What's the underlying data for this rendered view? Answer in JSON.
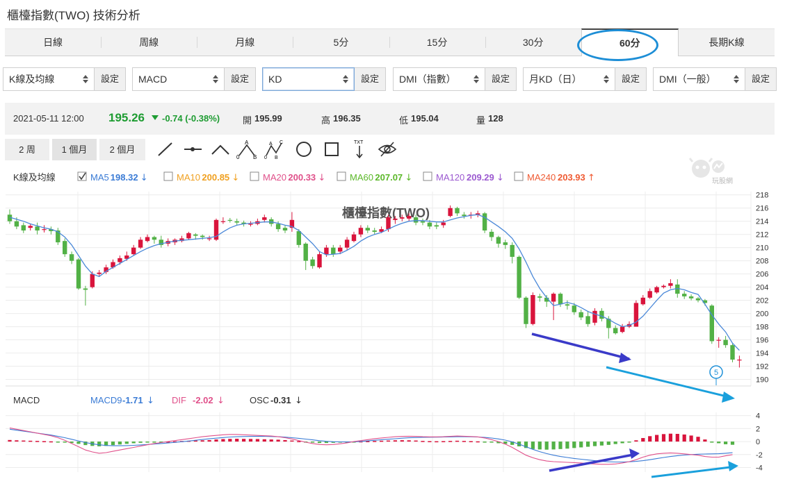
{
  "title": "櫃檯指數(TWO) 技術分析",
  "tabs": [
    {
      "label": "日線"
    },
    {
      "label": "周線"
    },
    {
      "label": "月線"
    },
    {
      "label": "5分"
    },
    {
      "label": "15分"
    },
    {
      "label": "30分"
    },
    {
      "label": "60分",
      "active": true
    },
    {
      "label": "長期K線"
    }
  ],
  "selectors": [
    {
      "value": "K線及均線",
      "button": "設定"
    },
    {
      "value": "MACD",
      "button": "設定"
    },
    {
      "value": "KD",
      "button": "設定"
    },
    {
      "value": "DMI（指數）",
      "button": "設定"
    },
    {
      "value": "月KD（日）",
      "button": "設定"
    },
    {
      "value": "DMI（一般）",
      "button": "設定"
    }
  ],
  "quote": {
    "time": "2021-05-11 12:00",
    "price": "195.26",
    "change": "-0.74 (-0.38%)",
    "open_label": "開",
    "open": "195.99",
    "high_label": "高",
    "high": "196.35",
    "low_label": "低",
    "low": "195.04",
    "vol_label": "量",
    "vol": "128"
  },
  "ranges": [
    {
      "label": "2 周"
    },
    {
      "label": "1 個月",
      "active": true
    },
    {
      "label": "2 個月"
    }
  ],
  "tools": [
    "line-tool-icon",
    "horizontal-line-icon",
    "angle-tool-icon",
    "abc-pattern-icon",
    "abcd-pattern-icon",
    "circle-tool-icon",
    "rectangle-tool-icon",
    "text-tool-icon",
    "hide-drawings-icon"
  ],
  "tool_text": {
    "a": "A",
    "b": "B",
    "c": "C",
    "zero": "0",
    "txt": "TXT"
  },
  "watermark": "櫃檯指數(TWO)",
  "logo": "玩股網",
  "colors": {
    "up": "#d9143c",
    "down": "#52b146",
    "ma5": "#4a88d8",
    "arrow_dark": "#3a3ac8",
    "arrow_light": "#1aa0dc"
  },
  "ma_legend": {
    "title": "K線及均線",
    "items": [
      {
        "name": "MA5",
        "value": "198.32",
        "arrow": "↓",
        "color": "#3a7bd5",
        "checked": true
      },
      {
        "name": "MA10",
        "value": "200.85",
        "arrow": "↓",
        "color": "#f0a020",
        "checked": false
      },
      {
        "name": "MA20",
        "value": "200.33",
        "arrow": "↓",
        "color": "#e0508a",
        "checked": false
      },
      {
        "name": "MA60",
        "value": "207.07",
        "arrow": "↓",
        "color": "#5cb82a",
        "checked": false
      },
      {
        "name": "MA120",
        "value": "209.29",
        "arrow": "↓",
        "color": "#9b59d0",
        "checked": false
      },
      {
        "name": "MA240",
        "value": "203.93",
        "arrow": "↑",
        "color": "#ef5a32",
        "checked": false
      }
    ]
  },
  "macd_legend": {
    "title": "MACD",
    "items": [
      {
        "name": "MACD9",
        "value": "-1.71",
        "arrow": "↓",
        "color": "#3a7bd5"
      },
      {
        "name": "DIF",
        "value": "-2.02",
        "arrow": "↓",
        "color": "#e0508a"
      },
      {
        "name": "OSC",
        "value": "-0.31",
        "arrow": "↓",
        "color": "#333333"
      }
    ]
  },
  "badge": "5",
  "chart_data": [
    {
      "type": "candlestick",
      "yticks": [
        "218",
        "216",
        "214",
        "212",
        "210",
        "208",
        "206",
        "204",
        "202",
        "200",
        "198",
        "196",
        "194",
        "192",
        "190"
      ],
      "ylim": [
        189,
        218.5
      ],
      "candles": [
        [
          215,
          214,
          215.8,
          213.6
        ],
        [
          214,
          213.2,
          214.6,
          212.8
        ],
        [
          213.4,
          212.6,
          213.8,
          212.2
        ],
        [
          213,
          213.3,
          213.6,
          212.6
        ],
        [
          213.2,
          212.6,
          213.8,
          212
        ],
        [
          212.8,
          212.8,
          213.4,
          212.3
        ],
        [
          212.8,
          212.5,
          213.2,
          212
        ],
        [
          212.6,
          210.8,
          213,
          210.4
        ],
        [
          211,
          209,
          211.4,
          208.6
        ],
        [
          209,
          208,
          209.4,
          207.5
        ],
        [
          208.2,
          203.8,
          208.4,
          203.6
        ],
        [
          203.8,
          203.6,
          204.2,
          201.2
        ],
        [
          204,
          206,
          206.4,
          203.8
        ],
        [
          206,
          206.2,
          206.6,
          205.6
        ],
        [
          206.3,
          207,
          207.4,
          206
        ],
        [
          207,
          207.8,
          208.2,
          206.8
        ],
        [
          207.8,
          208.4,
          208.8,
          207.4
        ],
        [
          208.3,
          208.8,
          209.4,
          208
        ],
        [
          209,
          210,
          210.4,
          208.8
        ],
        [
          210,
          211.2,
          211.6,
          209.8
        ],
        [
          211,
          211.6,
          212,
          210.8
        ],
        [
          211.6,
          211.2,
          211.8,
          210.6
        ],
        [
          211.2,
          210.4,
          211.8,
          210
        ],
        [
          210.6,
          211,
          211.4,
          210.2
        ],
        [
          210.8,
          211.2,
          211.4,
          210.4
        ],
        [
          211,
          211.4,
          211.8,
          210.8
        ],
        [
          211.4,
          212.2,
          212.4,
          211.2
        ],
        [
          212,
          211.8,
          212.2,
          211.2
        ],
        [
          211.8,
          211.6,
          212,
          211.2
        ],
        [
          211.4,
          211.4,
          211.8,
          211
        ],
        [
          211.2,
          214.2,
          214.4,
          211
        ],
        [
          214,
          214,
          214.6,
          213.6
        ],
        [
          214.2,
          214.1,
          214.5,
          213.8
        ],
        [
          214,
          213.8,
          214.4,
          213.4
        ],
        [
          213.8,
          213.6,
          214.1,
          213.2
        ],
        [
          213.6,
          213.6,
          214,
          213.2
        ],
        [
          213.6,
          214,
          214.4,
          213.4
        ],
        [
          214.2,
          214.6,
          215,
          213.8
        ],
        [
          214.3,
          213.6,
          214.6,
          213.2
        ],
        [
          213.6,
          212.8,
          214,
          212.4
        ],
        [
          213,
          212.6,
          213.4,
          212.2
        ],
        [
          213,
          214.2,
          215.4,
          212.4
        ],
        [
          212.5,
          210.4,
          212.8,
          210
        ],
        [
          210.6,
          208,
          210.8,
          206.6
        ],
        [
          208.2,
          207.2,
          208.6,
          206.8
        ],
        [
          207,
          209,
          209.4,
          206.8
        ],
        [
          209,
          210,
          210.4,
          208.6
        ],
        [
          210,
          209,
          210.4,
          208.6
        ],
        [
          209.4,
          210,
          210.4,
          209
        ],
        [
          210,
          211.2,
          211.6,
          209.6
        ],
        [
          211,
          212,
          212.4,
          210.8
        ],
        [
          212,
          213,
          213.4,
          211.6
        ],
        [
          213,
          212.6,
          213.4,
          212.2
        ],
        [
          212.6,
          212.4,
          213,
          212
        ],
        [
          212.4,
          212.8,
          213.2,
          212.2
        ],
        [
          212.8,
          214.6,
          215,
          212.4
        ],
        [
          214.2,
          214.4,
          214.8,
          213.6
        ],
        [
          214.4,
          214.6,
          215,
          214
        ],
        [
          214.4,
          214.8,
          215.2,
          214
        ],
        [
          214.6,
          213.8,
          215,
          213.4
        ],
        [
          214,
          213.8,
          214.4,
          213.4
        ],
        [
          213.8,
          213.2,
          214.2,
          212.8
        ],
        [
          213.4,
          213.2,
          213.8,
          212.8
        ],
        [
          213.4,
          213.8,
          214.2,
          213
        ],
        [
          214.8,
          216,
          216.4,
          214.6
        ],
        [
          216,
          215.2,
          216.2,
          214.8
        ],
        [
          215,
          214.8,
          215.4,
          214.4
        ],
        [
          215,
          215,
          215.4,
          214.4
        ],
        [
          215,
          215.2,
          215.6,
          214.6
        ],
        [
          215.2,
          212.6,
          215.4,
          212.2
        ],
        [
          212.4,
          211.6,
          212.8,
          211
        ],
        [
          211.6,
          210.6,
          211.8,
          210
        ],
        [
          210.8,
          210.4,
          211.2,
          209.8
        ],
        [
          210.4,
          208.6,
          210.8,
          207.6
        ],
        [
          208.6,
          202.4,
          208.8,
          202.2
        ],
        [
          202.4,
          198.4,
          202.6,
          197.8
        ],
        [
          198.4,
          202.8,
          203.2,
          198.2
        ],
        [
          202.6,
          202.4,
          203,
          201.8
        ],
        [
          202.4,
          201.8,
          202.8,
          201
        ],
        [
          201.8,
          203,
          203.2,
          199
        ],
        [
          203,
          201.4,
          203.2,
          201
        ],
        [
          201.4,
          201.2,
          202,
          200.6
        ],
        [
          201.2,
          200.2,
          201.6,
          199.8
        ],
        [
          200.2,
          199.4,
          200.6,
          199
        ],
        [
          199.6,
          198.4,
          200.4,
          198
        ],
        [
          198.6,
          200.4,
          200.8,
          198.2
        ],
        [
          200.4,
          199.2,
          200.8,
          198.8
        ],
        [
          199.2,
          197.8,
          199.6,
          196.2
        ],
        [
          197.8,
          197,
          198.2,
          196.8
        ],
        [
          197.2,
          198,
          198.4,
          197
        ],
        [
          198,
          198.4,
          198.8,
          197.8
        ],
        [
          198,
          201.6,
          202,
          198
        ],
        [
          201.4,
          202.4,
          202.8,
          201.2
        ],
        [
          202.4,
          203.4,
          203.8,
          202.2
        ],
        [
          203.2,
          204,
          204.2,
          203
        ],
        [
          204,
          204.2,
          204.4,
          203.8
        ],
        [
          204.2,
          204.6,
          205.2,
          203.8
        ],
        [
          204.4,
          203,
          205.2,
          202.4
        ],
        [
          203,
          202.6,
          203.4,
          202.2
        ],
        [
          202.6,
          202.3,
          202.9,
          202
        ],
        [
          202.3,
          202,
          202.5,
          201.7
        ],
        [
          202,
          201.6,
          202.2,
          201.2
        ],
        [
          201.2,
          195.8,
          201.4,
          195.4
        ],
        [
          196,
          196,
          196.4,
          194.8
        ],
        [
          196,
          195.2,
          196.6,
          194.8
        ],
        [
          195.2,
          193,
          195.4,
          192.6
        ],
        [
          193,
          193,
          193.6,
          191.8
        ]
      ],
      "ma5": [
        214.6,
        214.3,
        214,
        213.6,
        213.3,
        213,
        212.8,
        212.4,
        211.6,
        210.4,
        208.8,
        207.2,
        206,
        205.6,
        206.4,
        207,
        207.6,
        208.2,
        208.8,
        209.4,
        209.9,
        210.3,
        210.6,
        210.8,
        211,
        211.1,
        211.2,
        211.3,
        211.4,
        211.5,
        211.7,
        212.4,
        213,
        213.4,
        213.6,
        213.7,
        213.8,
        213.9,
        213.9,
        213.7,
        213.4,
        213.2,
        212.6,
        211.6,
        210.6,
        209.4,
        208.9,
        209,
        209.1,
        209.6,
        210.2,
        211,
        211.6,
        212,
        212.3,
        212.8,
        213.3,
        213.7,
        214,
        214.1,
        214.1,
        214,
        213.9,
        213.9,
        214.2,
        214.5,
        214.7,
        214.9,
        215,
        214.6,
        213.9,
        213.2,
        212.4,
        211.4,
        209.8,
        207.8,
        205.6,
        203.8,
        202.4,
        201.2,
        201.4,
        201.7,
        201.4,
        200.9,
        200.3,
        199.9,
        199.6,
        199.1,
        198.5,
        198,
        198.2,
        198.7,
        199.6,
        200.8,
        202,
        203.1,
        203.6,
        203.8,
        203.6,
        203.2,
        202.9,
        201.4,
        199.8,
        198.4,
        197.2,
        195.5,
        194.4
      ],
      "macd": {
        "ylim": [
          -4.7,
          4.5
        ],
        "yticks": [
          "4",
          "2",
          "0",
          "-2",
          "-4"
        ],
        "osc": [
          0.15,
          0.12,
          0.1,
          0.08,
          0.06,
          0.04,
          0.02,
          -0.02,
          -0.08,
          -0.14,
          -0.22,
          -0.34,
          -0.42,
          -0.46,
          -0.42,
          -0.34,
          -0.28,
          -0.22,
          -0.16,
          -0.12,
          -0.08,
          -0.05,
          -0.03,
          0,
          0.02,
          0.05,
          0.08,
          0.1,
          0.12,
          0.14,
          0.2,
          0.24,
          0.26,
          0.27,
          0.26,
          0.25,
          0.24,
          0.22,
          0.2,
          0.18,
          0.14,
          0.1,
          0.04,
          -0.04,
          -0.1,
          -0.14,
          -0.14,
          -0.12,
          -0.09,
          -0.06,
          -0.02,
          0.02,
          0.04,
          0.06,
          0.08,
          0.1,
          0.12,
          0.13,
          0.12,
          0.1,
          0.06,
          0.04,
          0.03,
          0.04,
          0.06,
          0.08,
          0.06,
          0.04,
          0.02,
          -0.04,
          -0.1,
          -0.16,
          -0.22,
          -0.32,
          -0.46,
          -0.62,
          -0.72,
          -0.76,
          -0.78,
          -0.76,
          -0.72,
          -0.68,
          -0.62,
          -0.56,
          -0.5,
          -0.44,
          -0.38,
          -0.32,
          -0.24,
          -0.16,
          -0.06,
          0.12,
          0.34,
          0.52,
          0.64,
          0.72,
          0.76,
          0.74,
          0.68,
          0.58,
          0.46,
          0.2,
          -0.02,
          -0.16,
          -0.26,
          -0.31
        ],
        "dif": [
          2.1,
          1.9,
          1.7,
          1.5,
          1.3,
          1.1,
          0.9,
          0.6,
          0.2,
          -0.3,
          -0.8,
          -1.3,
          -1.6,
          -1.8,
          -1.7,
          -1.5,
          -1.3,
          -1.1,
          -0.9,
          -0.7,
          -0.5,
          -0.3,
          -0.15,
          0,
          0.15,
          0.3,
          0.45,
          0.6,
          0.75,
          0.85,
          0.95,
          1.05,
          1.1,
          1.1,
          1.05,
          1,
          0.95,
          0.9,
          0.85,
          0.75,
          0.6,
          0.4,
          0.15,
          -0.1,
          -0.3,
          -0.45,
          -0.5,
          -0.45,
          -0.35,
          -0.2,
          0,
          0.15,
          0.3,
          0.45,
          0.55,
          0.65,
          0.75,
          0.8,
          0.82,
          0.8,
          0.75,
          0.72,
          0.72,
          0.75,
          0.8,
          0.85,
          0.82,
          0.78,
          0.72,
          0.55,
          0.3,
          0,
          -0.4,
          -0.9,
          -1.5,
          -2.1,
          -2.5,
          -2.8,
          -3,
          -3.1,
          -3.15,
          -3.2,
          -3.25,
          -3.3,
          -3.4,
          -3.45,
          -3.5,
          -3.5,
          -3.45,
          -3.3,
          -3.1,
          -2.8,
          -2.4,
          -2.1,
          -1.9,
          -1.8,
          -1.75,
          -1.8,
          -1.9,
          -2,
          -2.1,
          -2.3,
          -2.4,
          -2.4,
          -2.2,
          -2.02
        ],
        "macd9": [
          1.9,
          1.75,
          1.6,
          1.45,
          1.3,
          1.15,
          1,
          0.8,
          0.6,
          0.35,
          0.1,
          -0.15,
          -0.35,
          -0.5,
          -0.6,
          -0.65,
          -0.65,
          -0.62,
          -0.58,
          -0.52,
          -0.45,
          -0.38,
          -0.3,
          -0.22,
          -0.12,
          -0.02,
          0.08,
          0.2,
          0.32,
          0.42,
          0.52,
          0.62,
          0.7,
          0.75,
          0.78,
          0.8,
          0.8,
          0.8,
          0.78,
          0.74,
          0.68,
          0.6,
          0.5,
          0.38,
          0.26,
          0.14,
          0.04,
          -0.02,
          -0.05,
          -0.06,
          -0.04,
          0.02,
          0.1,
          0.2,
          0.28,
          0.36,
          0.44,
          0.52,
          0.58,
          0.62,
          0.65,
          0.67,
          0.68,
          0.7,
          0.72,
          0.74,
          0.74,
          0.73,
          0.7,
          0.64,
          0.54,
          0.4,
          0.22,
          -0.05,
          -0.4,
          -0.8,
          -1.2,
          -1.55,
          -1.85,
          -2.1,
          -2.3,
          -2.45,
          -2.6,
          -2.72,
          -2.84,
          -2.95,
          -3.05,
          -3.12,
          -3.15,
          -3.15,
          -3.12,
          -3.05,
          -2.95,
          -2.8,
          -2.62,
          -2.45,
          -2.3,
          -2.18,
          -2.08,
          -2,
          -1.95,
          -1.92,
          -1.9,
          -1.88,
          -1.8,
          -1.71
        ]
      }
    }
  ]
}
